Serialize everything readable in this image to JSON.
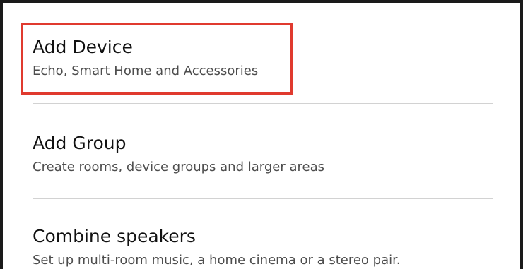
{
  "menu": {
    "items": [
      {
        "title": "Add Device",
        "subtitle": "Echo, Smart Home and Accessories"
      },
      {
        "title": "Add Group",
        "subtitle": "Create rooms, device groups and larger areas"
      },
      {
        "title": "Combine speakers",
        "subtitle": "Set up multi-room music, a home cinema or a stereo pair."
      }
    ]
  },
  "colors": {
    "highlight": "#e03a2f",
    "divider": "#d2d2d2",
    "title_text": "#111111",
    "subtitle_text": "#4d4d4d"
  }
}
